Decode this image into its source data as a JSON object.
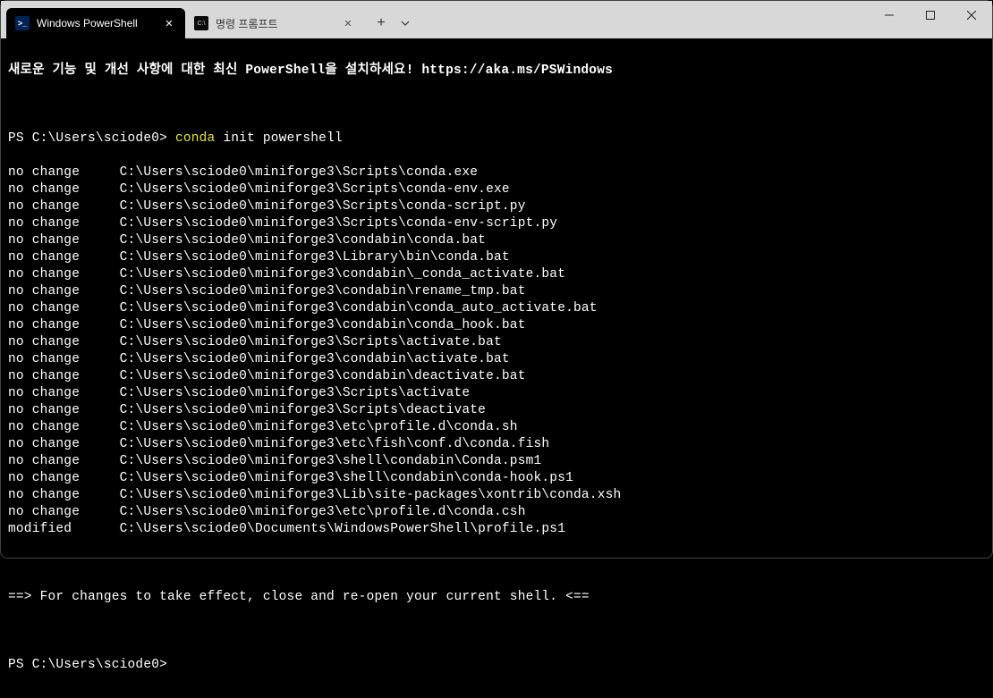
{
  "tabs": [
    {
      "title": "Windows PowerShell",
      "active": true,
      "icon": "powershell"
    },
    {
      "title": "명령 프롬프트",
      "active": false,
      "icon": "cmd"
    }
  ],
  "banner": "새로운 기능 및 개선 사항에 대한 최신 PowerShell을 설치하세요! https://aka.ms/PSWindows",
  "prompt1": "PS C:\\Users\\sciode0> ",
  "command_head": "conda",
  "command_rest": " init powershell",
  "output_lines": [
    "no change     C:\\Users\\sciode0\\miniforge3\\Scripts\\conda.exe",
    "no change     C:\\Users\\sciode0\\miniforge3\\Scripts\\conda-env.exe",
    "no change     C:\\Users\\sciode0\\miniforge3\\Scripts\\conda-script.py",
    "no change     C:\\Users\\sciode0\\miniforge3\\Scripts\\conda-env-script.py",
    "no change     C:\\Users\\sciode0\\miniforge3\\condabin\\conda.bat",
    "no change     C:\\Users\\sciode0\\miniforge3\\Library\\bin\\conda.bat",
    "no change     C:\\Users\\sciode0\\miniforge3\\condabin\\_conda_activate.bat",
    "no change     C:\\Users\\sciode0\\miniforge3\\condabin\\rename_tmp.bat",
    "no change     C:\\Users\\sciode0\\miniforge3\\condabin\\conda_auto_activate.bat",
    "no change     C:\\Users\\sciode0\\miniforge3\\condabin\\conda_hook.bat",
    "no change     C:\\Users\\sciode0\\miniforge3\\Scripts\\activate.bat",
    "no change     C:\\Users\\sciode0\\miniforge3\\condabin\\activate.bat",
    "no change     C:\\Users\\sciode0\\miniforge3\\condabin\\deactivate.bat",
    "no change     C:\\Users\\sciode0\\miniforge3\\Scripts\\activate",
    "no change     C:\\Users\\sciode0\\miniforge3\\Scripts\\deactivate",
    "no change     C:\\Users\\sciode0\\miniforge3\\etc\\profile.d\\conda.sh",
    "no change     C:\\Users\\sciode0\\miniforge3\\etc\\fish\\conf.d\\conda.fish",
    "no change     C:\\Users\\sciode0\\miniforge3\\shell\\condabin\\Conda.psm1",
    "no change     C:\\Users\\sciode0\\miniforge3\\shell\\condabin\\conda-hook.ps1",
    "no change     C:\\Users\\sciode0\\miniforge3\\Lib\\site-packages\\xontrib\\conda.xsh",
    "no change     C:\\Users\\sciode0\\miniforge3\\etc\\profile.d\\conda.csh",
    "modified      C:\\Users\\sciode0\\Documents\\WindowsPowerShell\\profile.ps1"
  ],
  "footer_msg": "==> For changes to take effect, close and re-open your current shell. <==",
  "prompt2": "PS C:\\Users\\sciode0>"
}
